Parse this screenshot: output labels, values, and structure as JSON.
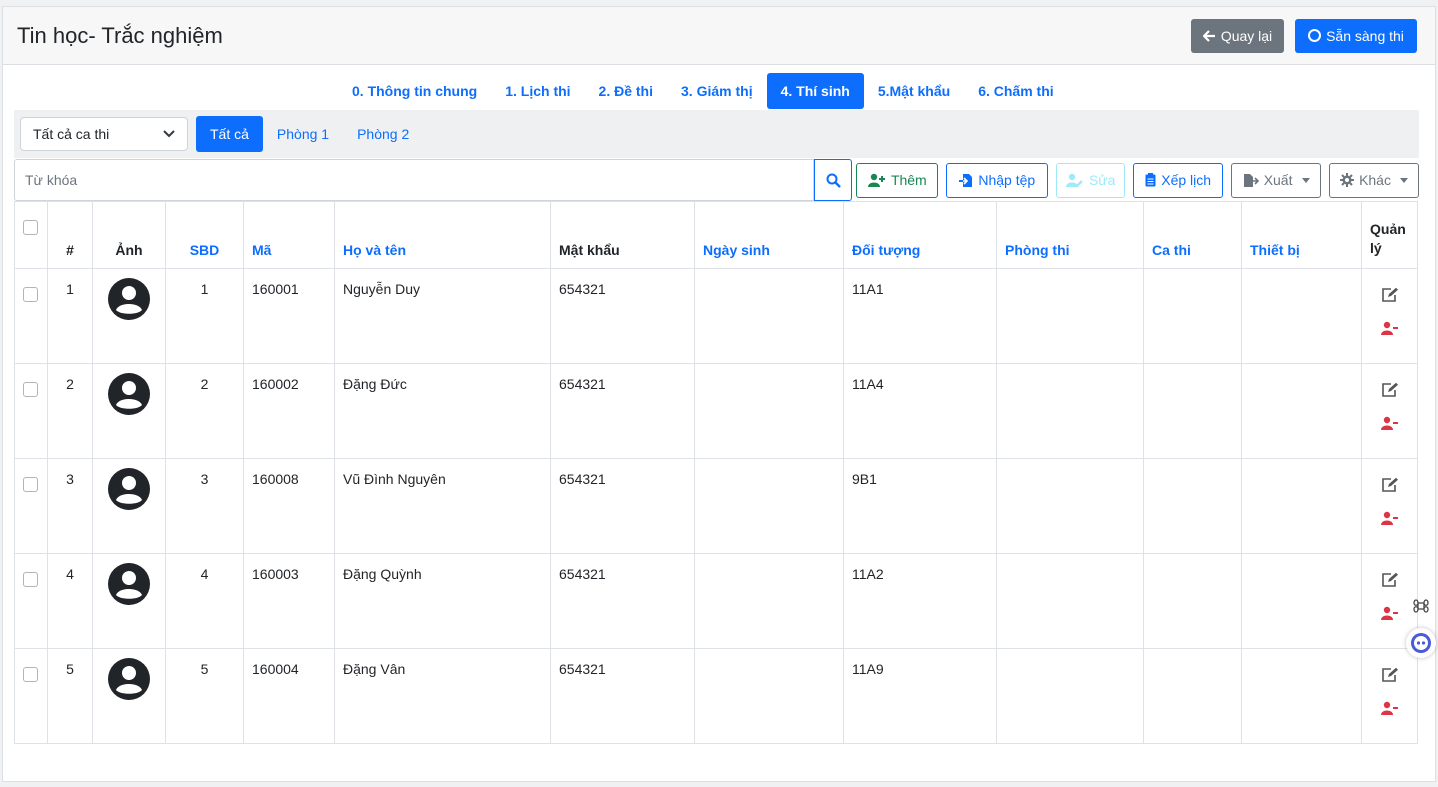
{
  "header": {
    "title": "Tin học- Trắc nghiệm",
    "back_label": "Quay lại",
    "ready_label": "Sẵn sàng thi"
  },
  "tabs": [
    {
      "label": "0. Thông tin chung",
      "active": false
    },
    {
      "label": "1. Lịch thi",
      "active": false
    },
    {
      "label": "2. Đề thi",
      "active": false
    },
    {
      "label": "3. Giám thị",
      "active": false
    },
    {
      "label": "4. Thí sinh",
      "active": true
    },
    {
      "label": "5.Mật khẩu",
      "active": false
    },
    {
      "label": "6. Chấm thi",
      "active": false
    }
  ],
  "filter": {
    "shift_select": "Tất cả ca thi",
    "rooms": [
      "Tất cả",
      "Phòng 1",
      "Phòng 2"
    ]
  },
  "toolbar": {
    "search_placeholder": "Từ khóa",
    "add_label": "Thêm",
    "import_label": "Nhập tệp",
    "edit_label": "Sửa",
    "schedule_label": "Xếp lịch",
    "export_label": "Xuất",
    "other_label": "Khác"
  },
  "table": {
    "headers": [
      "#",
      "Ảnh",
      "SBD",
      "Mã",
      "Họ và tên",
      "Mật khẩu",
      "Ngày sinh",
      "Đối tượng",
      "Phòng thi",
      "Ca thi",
      "Thiết bị",
      "Quản lý"
    ],
    "rows": [
      {
        "num": "1",
        "sbd": "1",
        "code": "160001",
        "name": "Nguyễn Duy",
        "password": "654321",
        "dob": "",
        "group": "11A1",
        "room": "",
        "shift": "",
        "device": ""
      },
      {
        "num": "2",
        "sbd": "2",
        "code": "160002",
        "name": "Đặng Đức",
        "password": "654321",
        "dob": "",
        "group": "11A4",
        "room": "",
        "shift": "",
        "device": ""
      },
      {
        "num": "3",
        "sbd": "3",
        "code": "160008",
        "name": "Vũ Đình Nguyên",
        "password": "654321",
        "dob": "",
        "group": "9B1",
        "room": "",
        "shift": "",
        "device": ""
      },
      {
        "num": "4",
        "sbd": "4",
        "code": "160003",
        "name": "Đặng Quỳnh",
        "password": "654321",
        "dob": "",
        "group": "11A2",
        "room": "",
        "shift": "",
        "device": ""
      },
      {
        "num": "5",
        "sbd": "5",
        "code": "160004",
        "name": "Đặng Vân",
        "password": "654321",
        "dob": "",
        "group": "11A9",
        "room": "",
        "shift": "",
        "device": ""
      }
    ]
  },
  "colors": {
    "primary": "#0d6efd",
    "secondary": "#6c757d",
    "success": "#198754",
    "danger": "#dc3545",
    "info_light": "#9eeaf9"
  },
  "icons": [
    "arrow-left-icon",
    "circle-icon",
    "chevron-down-icon",
    "search-icon",
    "user-plus-icon",
    "file-import-icon",
    "user-edit-icon",
    "clipboard-icon",
    "file-export-icon",
    "gear-icon",
    "edit-icon",
    "user-minus-icon",
    "avatar-icon",
    "command-icon",
    "bot-icon"
  ]
}
